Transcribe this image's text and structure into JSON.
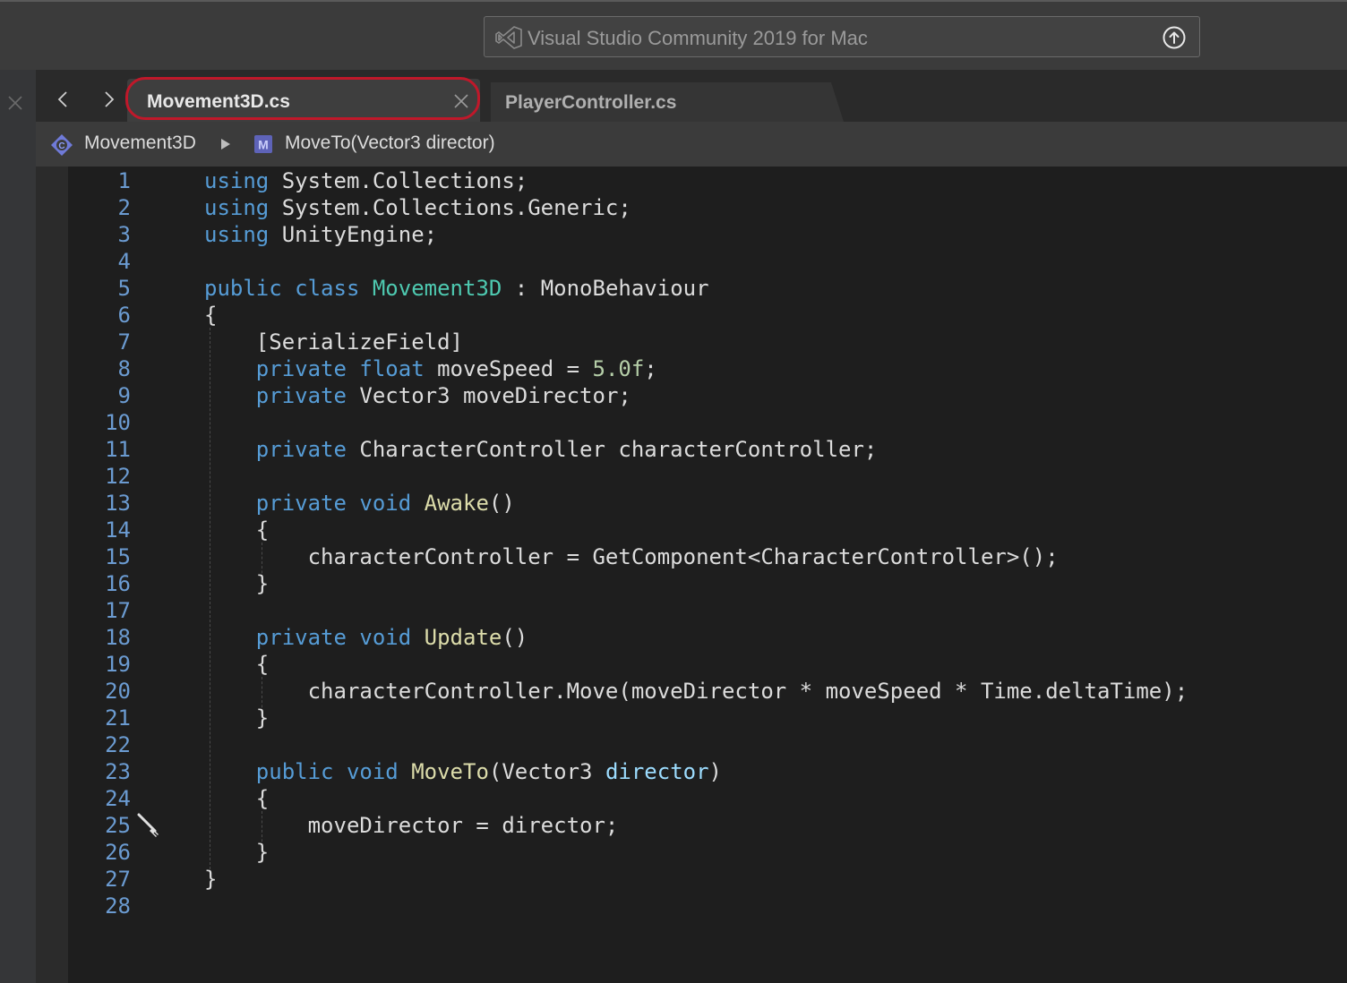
{
  "window": {
    "search_text": "Visual Studio Community 2019 for Mac"
  },
  "tabs": [
    {
      "label": "Movement3D.cs",
      "active": true
    },
    {
      "label": "PlayerController.cs",
      "active": false
    }
  ],
  "breadcrumb": {
    "class_name": "Movement3D",
    "method_name": "MoveTo(Vector3 director)"
  },
  "editor": {
    "line_numbers": [
      "1",
      "2",
      "3",
      "4",
      "5",
      "6",
      "7",
      "8",
      "9",
      "10",
      "11",
      "12",
      "13",
      "14",
      "15",
      "16",
      "17",
      "18",
      "19",
      "20",
      "21",
      "22",
      "23",
      "24",
      "25",
      "26",
      "27",
      "28"
    ],
    "lines": [
      "using System.Collections;",
      "using System.Collections.Generic;",
      "using UnityEngine;",
      "",
      "public class Movement3D : MonoBehaviour",
      "{",
      "    [SerializeField]",
      "    private float moveSpeed = 5.0f;",
      "    private Vector3 moveDirector;",
      "",
      "    private CharacterController characterController;",
      "",
      "    private void Awake()",
      "    {",
      "        characterController = GetComponent<CharacterController>();",
      "    }",
      "",
      "    private void Update()",
      "    {",
      "        characterController.Move(moveDirector * moveSpeed * Time.deltaTime);",
      "    }",
      "",
      "    public void MoveTo(Vector3 director)",
      "    {",
      "        moveDirector = director;",
      "    }",
      "}",
      ""
    ]
  },
  "colors": {
    "keyword": "#569cd6",
    "type": "#4ec9b0",
    "method": "#dcdcaa",
    "number": "#b5cea8",
    "parameter": "#9cdcfe",
    "line_number": "#6b9bd1",
    "active_tab_highlight": "#c0182a"
  },
  "icons": [
    "vs-logo-icon",
    "upload-icon",
    "close-icon",
    "back-arrow-icon",
    "forward-arrow-icon",
    "class-icon",
    "method-icon",
    "breadcrumb-arrow-icon",
    "pen-icon"
  ]
}
